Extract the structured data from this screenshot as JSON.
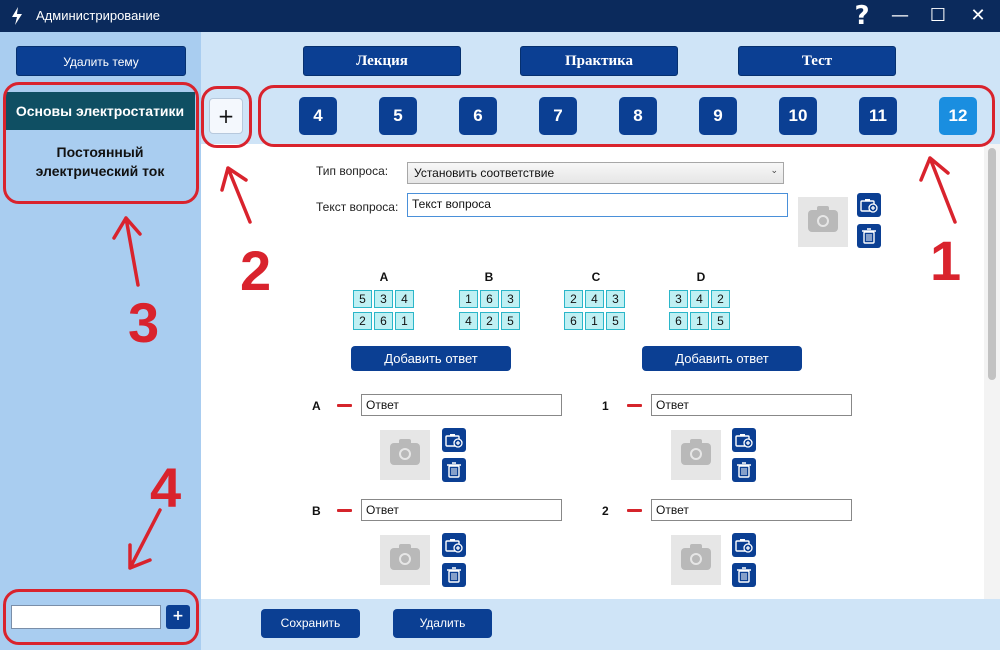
{
  "window": {
    "title": "Администрирование",
    "help": "?",
    "minimize": "—",
    "maximize": "☐",
    "close": "✕"
  },
  "sidebar": {
    "delete_topic": "Удалить тему",
    "topics": [
      {
        "label": "Основы электростатики"
      },
      {
        "label": "Постоянный электрический ток"
      }
    ],
    "add": "+"
  },
  "tabs": [
    {
      "label": "Лекция"
    },
    {
      "label": "Практика"
    },
    {
      "label": "Тест"
    }
  ],
  "questions": {
    "add": "+",
    "numbers": [
      "4",
      "5",
      "6",
      "7",
      "8",
      "9",
      "10",
      "11",
      "12"
    ],
    "active": "12"
  },
  "form": {
    "type_label": "Тип вопроса:",
    "type_value": "Установить соответствие",
    "text_label": "Текст вопроса:",
    "text_value": "Текст вопроса"
  },
  "grids": [
    {
      "letter": "A",
      "cells": [
        "5",
        "3",
        "4",
        "2",
        "6",
        "1"
      ]
    },
    {
      "letter": "B",
      "cells": [
        "1",
        "6",
        "3",
        "4",
        "2",
        "5"
      ]
    },
    {
      "letter": "C",
      "cells": [
        "2",
        "4",
        "3",
        "6",
        "1",
        "5"
      ]
    },
    {
      "letter": "D",
      "cells": [
        "3",
        "4",
        "2",
        "6",
        "1",
        "5"
      ]
    }
  ],
  "add_answer": "Добавить ответ",
  "answers_left": [
    {
      "label": "A",
      "value": "Ответ"
    },
    {
      "label": "B",
      "value": "Ответ"
    }
  ],
  "answers_right": [
    {
      "label": "1",
      "value": "Ответ"
    },
    {
      "label": "2",
      "value": "Ответ"
    }
  ],
  "footer": {
    "save": "Сохранить",
    "delete": "Удалить"
  },
  "annotations": [
    "1",
    "2",
    "3",
    "4"
  ],
  "colors": {
    "accent": "#0b3f93",
    "active": "#1a8ee0",
    "annotation": "#d9232d",
    "sidebar": "#a9cdf0",
    "panel": "#cfe4f7"
  }
}
